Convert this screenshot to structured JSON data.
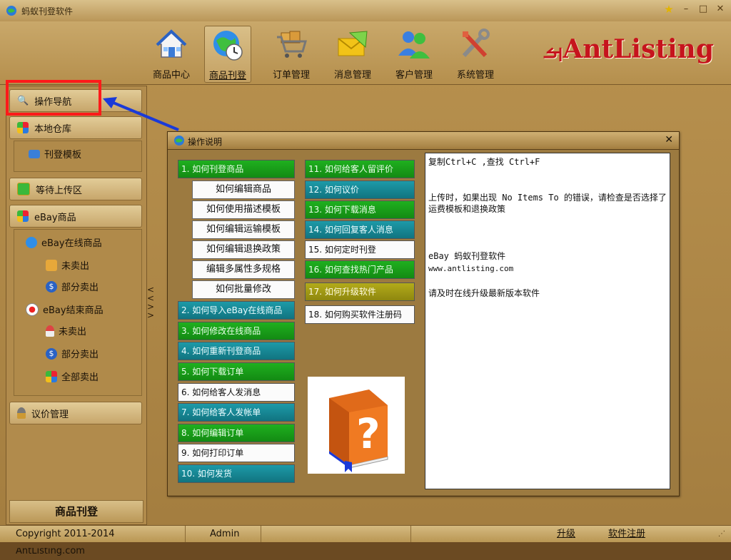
{
  "window": {
    "title": "蚂蚁刊登软件"
  },
  "nav": [
    {
      "label": "商品中心",
      "icon": "house-icon"
    },
    {
      "label": "商品刊登",
      "icon": "globe-clock-icon",
      "active": true
    },
    {
      "label": "订单管理",
      "icon": "cart-icon"
    },
    {
      "label": "消息管理",
      "icon": "envelope-icon"
    },
    {
      "label": "客户管理",
      "icon": "users-icon"
    },
    {
      "label": "系统管理",
      "icon": "tools-icon"
    }
  ],
  "brand": "AntListing",
  "sidebar": {
    "nav_header": "操作导航",
    "local_warehouse": "本地仓库",
    "listing_template": "刊登模板",
    "pending_upload": "等待上传区",
    "ebay_products": "eBay商品",
    "ebay_online": "eBay在线商品",
    "unsold": "未卖出",
    "partially_sold": "部分卖出",
    "ebay_ended": "eBay结束商品",
    "ended_unsold": "未卖出",
    "ended_partial": "部分卖出",
    "ended_all_sold": "全部卖出",
    "bargain_mgmt": "议价管理",
    "footer": "商品刊登"
  },
  "dialog": {
    "title": "操作说明",
    "topics_left": [
      {
        "label": "1. 如何刊登商品",
        "style": "green"
      },
      {
        "label": "2. 如何导入eBay在线商品",
        "style": "teal"
      },
      {
        "label": "3. 如何修改在线商品",
        "style": "green"
      },
      {
        "label": "4. 如何重新刊登商品",
        "style": "teal"
      },
      {
        "label": "5. 如何下载订单",
        "style": "green"
      },
      {
        "label": "6. 如何给客人发消息",
        "style": "white"
      },
      {
        "label": "7. 如何给客人发帐单",
        "style": "teal"
      },
      {
        "label": "8. 如何编辑订单",
        "style": "green"
      },
      {
        "label": "9. 如何打印订单",
        "style": "white"
      },
      {
        "label": "10. 如何发货",
        "style": "teal"
      }
    ],
    "subtopics": [
      "如何编辑商品",
      "如何使用描述模板",
      "如何编辑运输模板",
      "如何编辑退换政策",
      "编辑多属性多规格",
      "如何批量修改"
    ],
    "topics_right": [
      {
        "label": "11. 如何给客人留评价",
        "style": "green"
      },
      {
        "label": "12. 如何议价",
        "style": "teal"
      },
      {
        "label": "13. 如何下载消息",
        "style": "green"
      },
      {
        "label": "14. 如何回复客人消息",
        "style": "teal"
      },
      {
        "label": "15. 如何定时刊登",
        "style": "white"
      },
      {
        "label": "16. 如何查找热门产品",
        "style": "green"
      },
      {
        "label": "17. 如何升级软件",
        "style": "olive"
      },
      {
        "label": "18. 如何购买软件注册码",
        "style": "white"
      }
    ],
    "info": {
      "line1": "复制Ctrl+C ,查找 Ctrl+F",
      "line2": "上传时，如果出现 No Items To 的错误，请检查是否选择了运费模板和退换政策",
      "line3": "eBay 蚂蚁刊登软件",
      "line4": "www.antlisting.com",
      "line5": "请及时在线升级最新版本软件"
    }
  },
  "status": {
    "copyright": "Copyright 2011-2014  AntListing.com",
    "user": "Admin",
    "upgrade": "升级",
    "register": "软件注册"
  },
  "colors": {
    "highlight": "#ff1a1a",
    "arrow": "#1a3ad8",
    "brand": "#c6141d"
  }
}
